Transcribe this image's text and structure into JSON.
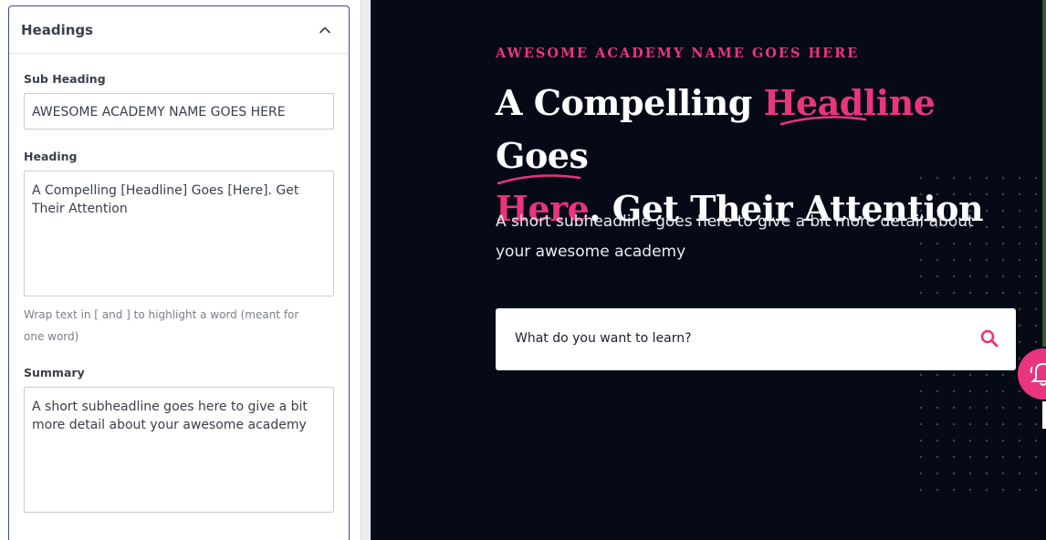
{
  "editor": {
    "section_title": "Headings",
    "subheading": {
      "label": "Sub Heading",
      "value": "AWESOME ACADEMY NAME GOES HERE"
    },
    "heading": {
      "label": "Heading",
      "value": "A Compelling [Headline] Goes [Here]. Get Their Attention",
      "help": "Wrap text in [ and ] to highlight a word (meant for one word)"
    },
    "summary": {
      "label": "Summary",
      "value": "A short subheadline goes here to give a bit more detail about your awesome academy"
    }
  },
  "preview": {
    "eyebrow": "AWESOME ACADEMY NAME GOES HERE",
    "headline_parts": {
      "p1": "A Compelling ",
      "h1": "Headline",
      "p2": " Goes",
      "h2": "Here",
      "p3": ". Get Their Attention"
    },
    "summary": "A short subheadline goes here to give a bit more detail about your awesome academy",
    "search_placeholder": "What do you want to learn?"
  },
  "colors": {
    "accent": "#e8357e",
    "preview_bg": "#060a17",
    "panel_border": "#3b4a9e"
  },
  "icons": {
    "collapse": "chevron-up-icon",
    "search": "search-icon",
    "notification": "bell-icon"
  }
}
